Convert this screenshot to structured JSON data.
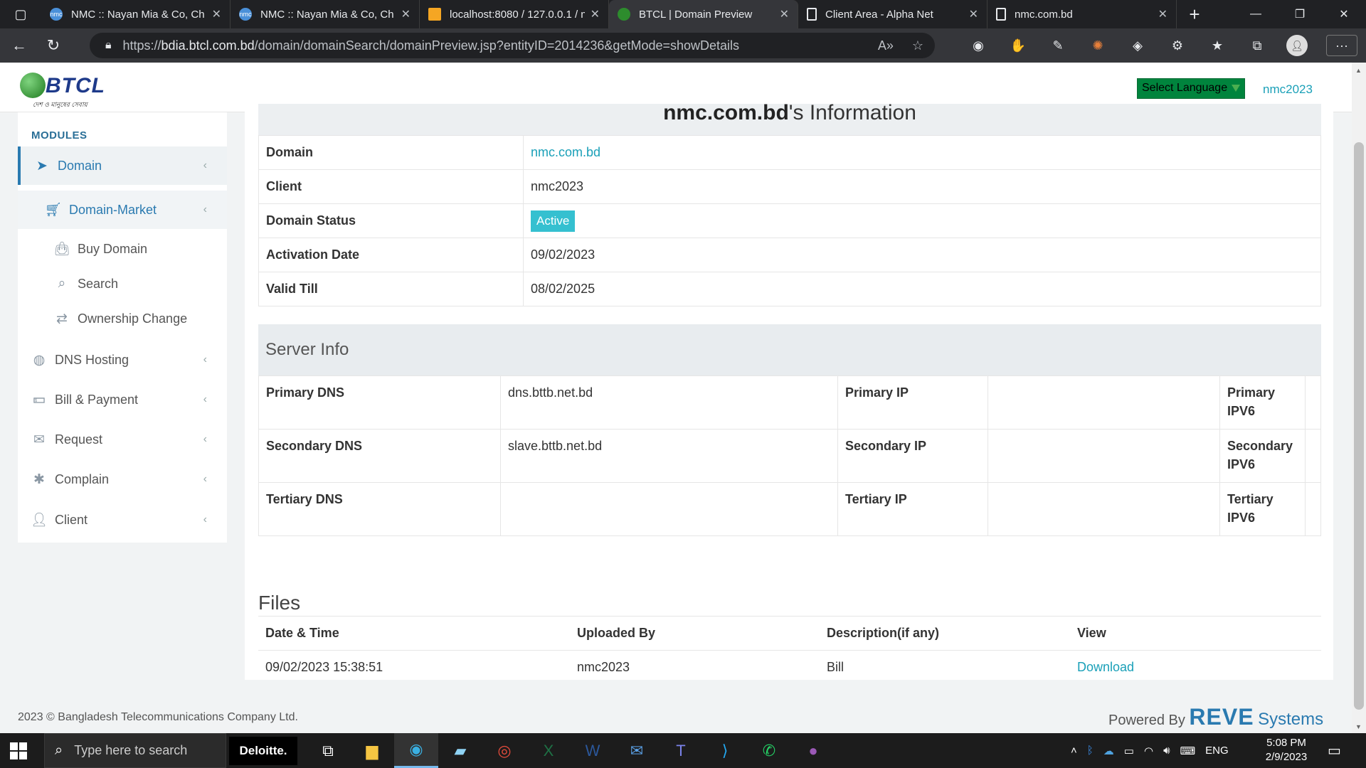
{
  "browser": {
    "tabs": [
      {
        "title": "NMC :: Nayan Mia & Co, Ch",
        "icon": "nmc-favicon",
        "active": false
      },
      {
        "title": "NMC :: Nayan Mia & Co, Ch",
        "icon": "nmc-favicon",
        "active": false
      },
      {
        "title": "localhost:8080 / 127.0.0.1 / n",
        "icon": "phpmyadmin-favicon",
        "active": false
      },
      {
        "title": "BTCL | Domain Preview",
        "icon": "btcl-favicon",
        "active": true
      },
      {
        "title": "Client Area - Alpha Net",
        "icon": "document-icon",
        "active": false
      },
      {
        "title": "nmc.com.bd",
        "icon": "document-icon",
        "active": false
      }
    ],
    "url_prefix": "https://",
    "url_host": "bdia.btcl.com.bd",
    "url_path": "/domain/domainSearch/domainPreview.jsp?entityID=2014236&getMode=showDetails"
  },
  "header": {
    "logo_text": "BTCL",
    "logo_tagline": "দেশ ও মানুষের সেবায়",
    "language_select": "Select Language",
    "user": "nmc2023"
  },
  "sidebar": {
    "title": "MODULES",
    "items": [
      {
        "label": "Domain",
        "icon": "paper-plane-icon"
      },
      {
        "label": "Domain-Market",
        "icon": "cart-icon"
      },
      {
        "label": "Buy Domain",
        "icon": "shopping-bag-icon"
      },
      {
        "label": "Search",
        "icon": "search-icon"
      },
      {
        "label": "Ownership Change",
        "icon": "transfer-icon"
      },
      {
        "label": "DNS Hosting",
        "icon": "globe-icon"
      },
      {
        "label": "Bill & Payment",
        "icon": "money-icon"
      },
      {
        "label": "Request",
        "icon": "envelope-icon"
      },
      {
        "label": "Complain",
        "icon": "bug-icon"
      },
      {
        "label": "Client",
        "icon": "user-icon"
      }
    ]
  },
  "info": {
    "heading_domain": "nmc.com.bd",
    "heading_suffix": "'s Information",
    "rows": [
      {
        "key": "Domain",
        "value": "nmc.com.bd"
      },
      {
        "key": "Client",
        "value": "nmc2023"
      },
      {
        "key": "Domain Status",
        "value": "Active"
      },
      {
        "key": "Activation Date",
        "value": "09/02/2023"
      },
      {
        "key": "Valid Till",
        "value": "08/02/2025"
      }
    ]
  },
  "server": {
    "title": "Server Info",
    "rows": [
      {
        "dns_label": "Primary DNS",
        "dns": "dns.bttb.net.bd",
        "ip_label": "Primary IP",
        "ip": "",
        "ipv6_label": "Primary IPV6",
        "ipv6": ""
      },
      {
        "dns_label": "Secondary DNS",
        "dns": "slave.bttb.net.bd",
        "ip_label": "Secondary IP",
        "ip": "",
        "ipv6_label": "Secondary IPV6",
        "ipv6": ""
      },
      {
        "dns_label": "Tertiary DNS",
        "dns": "",
        "ip_label": "Tertiary IP",
        "ip": "",
        "ipv6_label": "Tertiary IPV6",
        "ipv6": ""
      }
    ]
  },
  "files": {
    "title": "Files",
    "columns": [
      "Date & Time",
      "Uploaded By",
      "Description(if any)",
      "View"
    ],
    "rows": [
      {
        "datetime": "09/02/2023 15:38:51",
        "uploaded_by": "nmc2023",
        "description": "Bill",
        "view": "Download"
      }
    ]
  },
  "footer": {
    "copyright": "2023 © Bangladesh Telecommunications Company Ltd.",
    "powered_by": "Powered By",
    "brand": "REVE",
    "brand_suffix": "Systems"
  },
  "taskbar": {
    "search_placeholder": "Type here to search",
    "deloitte": "Deloitte.",
    "language": "ENG",
    "time": "5:08 PM",
    "date": "2/9/2023"
  },
  "colors": {
    "accent": "#1aa0b8",
    "active_badge": "#35c0d0",
    "sidebar_active": "#2a7ab0",
    "language_select_bg": "#00843d"
  }
}
